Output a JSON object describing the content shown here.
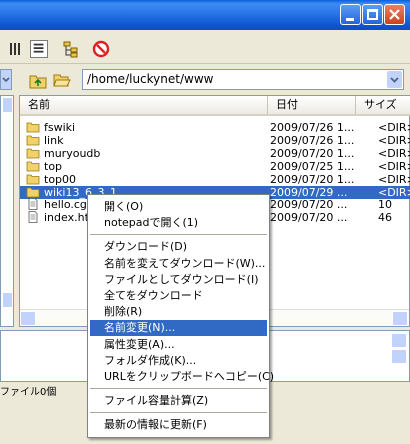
{
  "titlebar": {
    "buttons": [
      "minimize",
      "maximize",
      "close"
    ]
  },
  "toolbar": {
    "icons": [
      "list-view-icon",
      "details-view-icon",
      "tree-icon",
      "stop-icon"
    ]
  },
  "address": {
    "path": "/home/luckynet/www"
  },
  "list": {
    "columns": [
      "名前",
      "日付",
      "サイズ"
    ],
    "rows": [
      {
        "name": "fswiki",
        "date": "2009/07/26 1...",
        "size": "<DIR>",
        "type": "folder",
        "selected": false
      },
      {
        "name": "link",
        "date": "2009/07/26 1...",
        "size": "<DIR>",
        "type": "folder",
        "selected": false
      },
      {
        "name": "muryoudb",
        "date": "2009/07/20 1...",
        "size": "<DIR>",
        "type": "folder",
        "selected": false
      },
      {
        "name": "top",
        "date": "2009/07/25 1...",
        "size": "<DIR>",
        "type": "folder",
        "selected": false
      },
      {
        "name": "top00",
        "date": "2009/07/20 1...",
        "size": "<DIR>",
        "type": "folder",
        "selected": false
      },
      {
        "name": "wiki13_6_3_1",
        "date": "2009/07/29 ...",
        "size": "<DIR>",
        "type": "folder",
        "selected": true
      },
      {
        "name": "hello.cgi",
        "date": "2009/07/20 ...",
        "size": "10",
        "type": "file",
        "selected": false
      },
      {
        "name": "index.htm",
        "date": "2009/07/20 ...",
        "size": "46",
        "type": "file",
        "selected": false
      }
    ]
  },
  "status": {
    "text": "ファイル0個"
  },
  "context_menu": {
    "groups": [
      [
        "開く(O)",
        "notepadで開く(1)"
      ],
      [
        "ダウンロード(D)",
        "名前を変えてダウンロード(W)...",
        "ファイルとしてダウンロード(I)",
        "全てをダウンロード",
        "削除(R)",
        "名前変更(N)...",
        "属性変更(A)...",
        "フォルダ作成(K)...",
        "URLをクリップボードへコピー(C)"
      ],
      [
        "ファイル容量計算(Z)"
      ],
      [
        "最新の情報に更新(F)"
      ]
    ],
    "highlighted": "名前変更(N)..."
  }
}
